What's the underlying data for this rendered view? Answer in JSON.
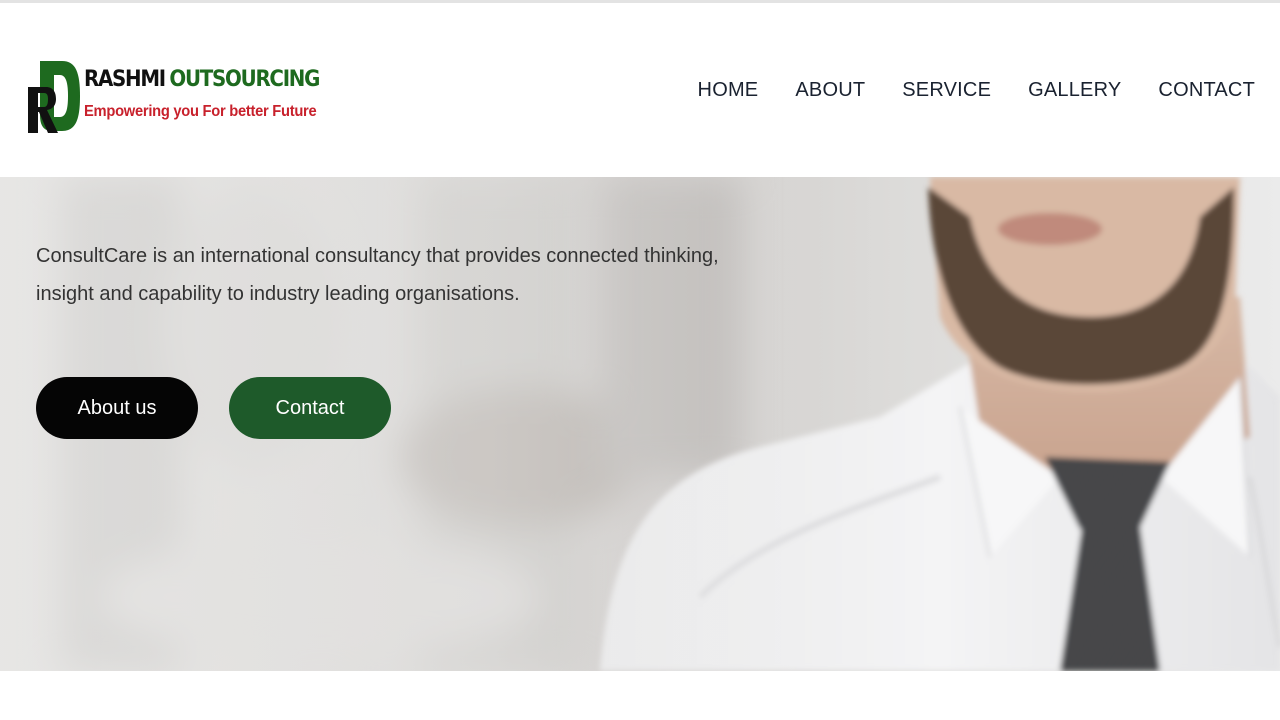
{
  "brand": {
    "monogram": "RO",
    "name_first": "RASHMI",
    "name_second": "OUTSOURCING",
    "tagline": "Empowering you For better Future",
    "colors": {
      "dark": "#111111",
      "green": "#1e6a1f",
      "red": "#c8212c"
    }
  },
  "nav": {
    "items": [
      {
        "label": "HOME"
      },
      {
        "label": "ABOUT"
      },
      {
        "label": "SERVICE"
      },
      {
        "label": "GALLERY"
      },
      {
        "label": "CONTACT"
      }
    ]
  },
  "hero": {
    "text_line1": "ConsultCare is an international consultancy that provides connected thinking,",
    "text_line2": "insight and capability to industry leading organisations.",
    "buttons": {
      "about": "About us",
      "contact": "Contact"
    },
    "colors": {
      "about_button": "#050505",
      "contact_button": "#1e5a2a"
    }
  }
}
